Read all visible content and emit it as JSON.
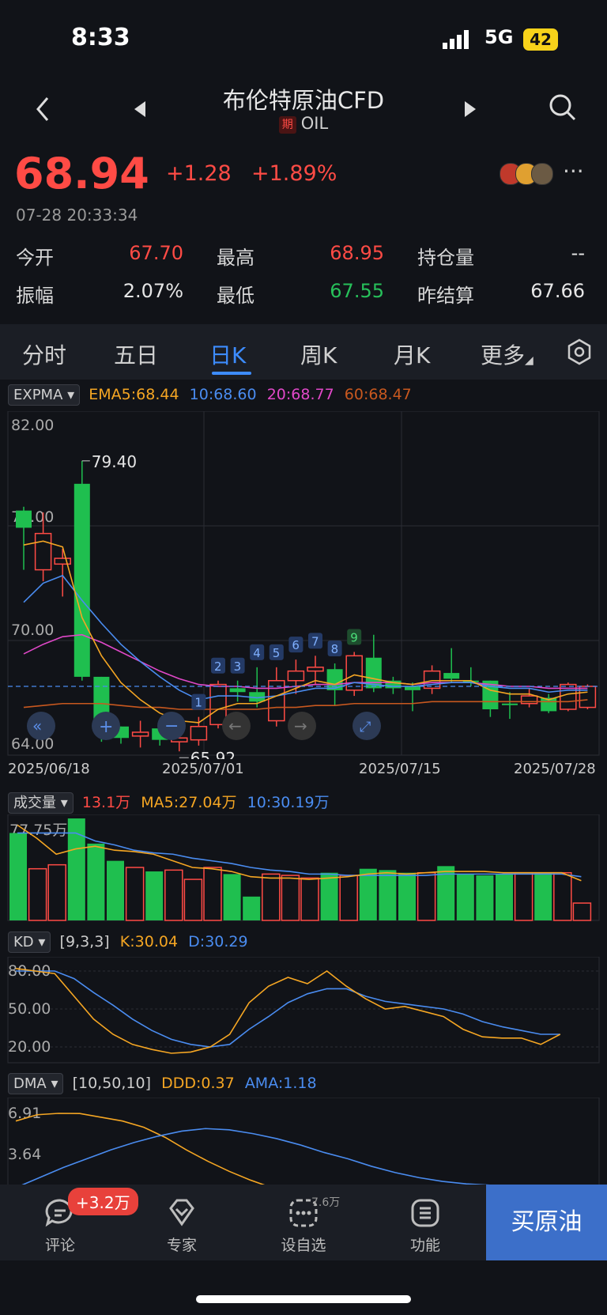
{
  "status": {
    "time": "8:33",
    "network": "5G",
    "battery": "42"
  },
  "header": {
    "title": "布伦特原油CFD",
    "tag": "期",
    "code": "OIL"
  },
  "quote": {
    "price": "68.94",
    "change": "+1.28",
    "change_pct": "+1.89%",
    "timestamp": "07-28 20:33:34"
  },
  "stats": [
    {
      "label": "今开",
      "value": "67.70",
      "color": "red"
    },
    {
      "label": "最高",
      "value": "68.95",
      "color": "red"
    },
    {
      "label": "持仓量",
      "value": "--",
      "color": "white"
    },
    {
      "label": "振幅",
      "value": "2.07%",
      "color": "white"
    },
    {
      "label": "最低",
      "value": "67.55",
      "color": "green"
    },
    {
      "label": "昨结算",
      "value": "67.66",
      "color": "white"
    }
  ],
  "tabs": [
    "分时",
    "五日",
    "日K",
    "周K",
    "月K",
    "更多"
  ],
  "active_tab": "日K",
  "main_chart": {
    "indicator": "EXPMA",
    "ema5": "EMA5:68.44",
    "ema10": "10:68.60",
    "ema20": "20:68.77",
    "ema60": "60:68.47",
    "y_top": "82.00",
    "y_mid1": "76.00",
    "y_mid2": "70.00",
    "y_bottom": "64.00",
    "high_label": "79.40",
    "low_label": "65.92",
    "dates": [
      "2025/06/18",
      "2025/07/01",
      "2025/07/15",
      "2025/07/28"
    ],
    "nine_counts": [
      "1",
      "2",
      "3",
      "4",
      "5",
      "6",
      "7",
      "8",
      "9"
    ]
  },
  "volume": {
    "indicator": "成交量",
    "current": "13.1万",
    "ma5": "MA5:27.04万",
    "ma10": "10:30.19万",
    "y_top": "77.75万"
  },
  "kd": {
    "indicator": "KD",
    "params": "[9,3,3]",
    "k": "K:30.04",
    "d": "D:30.29",
    "y1": "80.00",
    "y2": "50.00",
    "y3": "20.00"
  },
  "dma": {
    "indicator": "DMA",
    "params": "[10,50,10]",
    "ddd": "DDD:0.37",
    "ama": "AMA:1.18",
    "y1": "6.91",
    "y2": "3.64"
  },
  "bottom_nav": {
    "comment": "评论",
    "comment_badge": "+3.2万",
    "expert": "专家",
    "watch": "设自选",
    "watch_count": "7.6万",
    "func": "功能",
    "buy": "买原油"
  },
  "chart_data": {
    "type": "candlestick",
    "y_range": [
      64.0,
      82.0
    ],
    "candles": [
      {
        "o": 76.8,
        "c": 75.9,
        "h": 77.0,
        "l": 73.7,
        "dir": "down"
      },
      {
        "o": 73.7,
        "c": 75.6,
        "h": 76.7,
        "l": 73.1,
        "dir": "up"
      },
      {
        "o": 74.0,
        "c": 74.3,
        "h": 74.8,
        "l": 72.3,
        "dir": "up"
      },
      {
        "o": 78.2,
        "c": 68.1,
        "h": 79.4,
        "l": 67.9,
        "dir": "down"
      },
      {
        "o": 68.1,
        "c": 65.2,
        "h": 68.1,
        "l": 64.7,
        "dir": "down"
      },
      {
        "o": 65.5,
        "c": 64.9,
        "h": 65.5,
        "l": 64.6,
        "dir": "down"
      },
      {
        "o": 65.0,
        "c": 65.2,
        "h": 65.8,
        "l": 64.4,
        "dir": "up"
      },
      {
        "o": 65.4,
        "c": 64.8,
        "h": 65.4,
        "l": 64.5,
        "dir": "down"
      },
      {
        "o": 64.7,
        "c": 64.9,
        "h": 65.4,
        "l": 64.2,
        "dir": "up"
      },
      {
        "o": 64.8,
        "c": 65.5,
        "h": 66.0,
        "l": 64.5,
        "dir": "up"
      },
      {
        "o": 65.6,
        "c": 67.7,
        "h": 67.9,
        "l": 65.4,
        "dir": "up"
      },
      {
        "o": 67.5,
        "c": 67.3,
        "h": 67.9,
        "l": 66.8,
        "dir": "down"
      },
      {
        "o": 67.3,
        "c": 66.8,
        "h": 68.6,
        "l": 66.5,
        "dir": "down"
      },
      {
        "o": 65.8,
        "c": 67.9,
        "h": 68.6,
        "l": 65.5,
        "dir": "up"
      },
      {
        "o": 67.9,
        "c": 68.4,
        "h": 69.0,
        "l": 67.2,
        "dir": "up"
      },
      {
        "o": 68.4,
        "c": 68.6,
        "h": 69.2,
        "l": 67.7,
        "dir": "up"
      },
      {
        "o": 68.5,
        "c": 67.4,
        "h": 68.8,
        "l": 66.6,
        "dir": "down"
      },
      {
        "o": 67.4,
        "c": 69.2,
        "h": 69.4,
        "l": 67.1,
        "dir": "up"
      },
      {
        "o": 69.1,
        "c": 67.5,
        "h": 70.3,
        "l": 67.3,
        "dir": "down"
      },
      {
        "o": 67.9,
        "c": 67.5,
        "h": 68.1,
        "l": 67.2,
        "dir": "down"
      },
      {
        "o": 67.6,
        "c": 67.4,
        "h": 67.8,
        "l": 66.3,
        "dir": "down"
      },
      {
        "o": 67.5,
        "c": 68.4,
        "h": 68.7,
        "l": 67.2,
        "dir": "up"
      },
      {
        "o": 68.3,
        "c": 68.0,
        "h": 69.6,
        "l": 67.8,
        "dir": "down"
      },
      {
        "o": 67.9,
        "c": 67.9,
        "h": 68.6,
        "l": 67.6,
        "dir": "down"
      },
      {
        "o": 67.9,
        "c": 66.4,
        "h": 67.9,
        "l": 66.0,
        "dir": "down"
      },
      {
        "o": 66.7,
        "c": 66.7,
        "h": 67.3,
        "l": 65.9,
        "dir": "down"
      },
      {
        "o": 66.7,
        "c": 67.1,
        "h": 67.5,
        "l": 66.5,
        "dir": "up"
      },
      {
        "o": 67.0,
        "c": 66.3,
        "h": 67.2,
        "l": 66.2,
        "dir": "down"
      },
      {
        "o": 66.4,
        "c": 67.7,
        "h": 67.8,
        "l": 66.3,
        "dir": "up"
      },
      {
        "o": 66.5,
        "c": 67.6,
        "h": 67.7,
        "l": 66.4,
        "dir": "up"
      }
    ],
    "volumes": [
      66,
      39,
      42,
      77,
      58,
      45,
      40,
      37,
      38,
      31,
      40,
      35,
      18,
      35,
      34,
      32,
      36,
      34,
      39,
      38,
      36,
      36,
      41,
      35,
      34,
      35,
      36,
      36,
      36,
      13.1
    ],
    "ema5": [
      75.0,
      75.2,
      74.9,
      71.2,
      69.2,
      67.8,
      66.9,
      66.2,
      65.8,
      65.7,
      66.4,
      66.7,
      66.7,
      67.1,
      67.5,
      67.9,
      67.7,
      68.2,
      68.0,
      67.8,
      67.7,
      67.9,
      67.9,
      67.9,
      67.4,
      67.2,
      67.2,
      66.9,
      67.2,
      67.3
    ],
    "ema10": [
      72.0,
      73.0,
      73.4,
      72.1,
      70.9,
      69.8,
      68.9,
      68.1,
      67.4,
      66.9,
      67.1,
      67.1,
      67.0,
      67.1,
      67.3,
      67.5,
      67.5,
      67.8,
      67.7,
      67.6,
      67.6,
      67.7,
      67.8,
      67.8,
      67.6,
      67.5,
      67.5,
      67.3,
      67.4,
      67.4
    ],
    "ema20": [
      69.3,
      69.8,
      70.2,
      70.3,
      69.9,
      69.4,
      68.9,
      68.4,
      68.0,
      67.7,
      67.6,
      67.6,
      67.5,
      67.5,
      67.6,
      67.7,
      67.7,
      67.8,
      67.8,
      67.8,
      67.7,
      67.8,
      67.8,
      67.8,
      67.7,
      67.6,
      67.6,
      67.5,
      67.5,
      67.5
    ],
    "ema60": [
      66.5,
      66.6,
      66.7,
      66.7,
      66.7,
      66.6,
      66.5,
      66.5,
      66.4,
      66.4,
      66.4,
      66.4,
      66.4,
      66.5,
      66.5,
      66.6,
      66.6,
      66.7,
      66.7,
      66.7,
      66.7,
      66.8,
      66.8,
      66.8,
      66.8,
      66.8,
      66.8,
      66.8,
      66.8,
      66.9
    ],
    "vol_ma5": [
      72,
      62,
      50,
      54,
      56,
      53,
      52,
      50,
      45,
      40,
      39,
      37,
      33,
      32,
      32,
      31,
      32,
      33,
      35,
      36,
      35,
      36,
      37,
      37,
      37,
      36,
      36,
      36,
      36,
      30
    ],
    "vol_ma10": [
      66,
      66,
      66,
      66,
      60,
      57,
      53,
      51,
      50,
      47,
      45,
      43,
      40,
      38,
      37,
      35,
      35,
      34,
      34,
      34,
      34,
      34,
      35,
      35,
      35,
      35,
      35,
      35,
      35,
      33
    ],
    "kd_k": [
      82,
      80,
      78,
      60,
      42,
      30,
      22,
      18,
      15,
      16,
      20,
      30,
      55,
      68,
      75,
      70,
      80,
      68,
      58,
      50,
      52,
      48,
      44,
      34,
      28,
      27,
      27,
      22,
      30
    ],
    "kd_d": [
      80,
      80,
      80,
      74,
      63,
      53,
      42,
      33,
      26,
      22,
      20,
      22,
      34,
      44,
      55,
      62,
      66,
      66,
      60,
      56,
      54,
      52,
      50,
      46,
      40,
      36,
      33,
      30,
      30
    ],
    "dma_ddd": [
      6.3,
      6.8,
      6.91,
      6.9,
      6.6,
      6.3,
      5.8,
      5.0,
      4.0,
      3.1,
      2.3,
      1.6,
      1.0,
      0.7,
      0.8,
      1.0,
      1.2,
      1.1,
      0.9,
      0.8,
      0.7,
      0.6,
      0.5,
      0.4,
      0.4,
      0.37
    ],
    "dma_ama": [
      1.0,
      1.8,
      2.6,
      3.3,
      4.0,
      4.6,
      5.1,
      5.5,
      5.7,
      5.6,
      5.3,
      4.9,
      4.4,
      3.8,
      3.3,
      2.7,
      2.2,
      1.8,
      1.5,
      1.3,
      1.2,
      1.18
    ]
  }
}
